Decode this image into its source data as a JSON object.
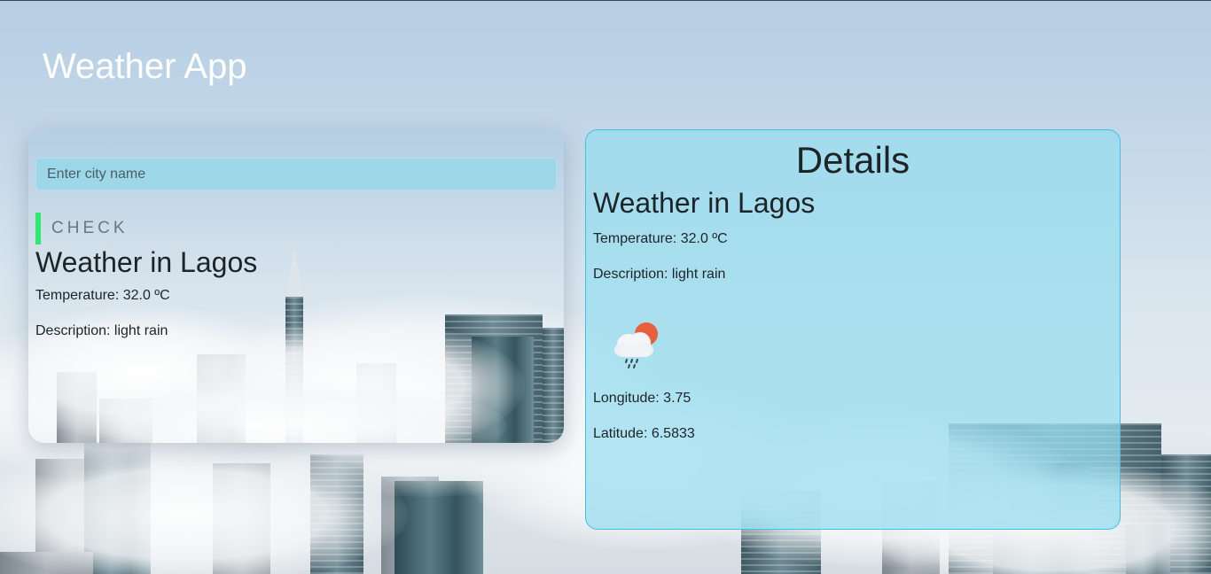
{
  "app": {
    "title": "Weather App"
  },
  "search": {
    "placeholder": "Enter city name",
    "value": "",
    "check_label": "CHECK",
    "accent_color": "#2ee86f"
  },
  "summary": {
    "heading": "Weather in Lagos",
    "temperature": "Temperature: 32.0 ºC",
    "description": "Description: light rain"
  },
  "details": {
    "title": "Details",
    "heading": "Weather in Lagos",
    "temperature": "Temperature: 32.0 ºC",
    "description": "Description: light rain",
    "icon": "sun-cloud-rain-icon",
    "longitude": "Longitude: 3.75",
    "latitude": "Latitude: 6.5833",
    "border_color": "#3ec2e0"
  },
  "background": {
    "scene": "city-skyline-above-clouds"
  }
}
